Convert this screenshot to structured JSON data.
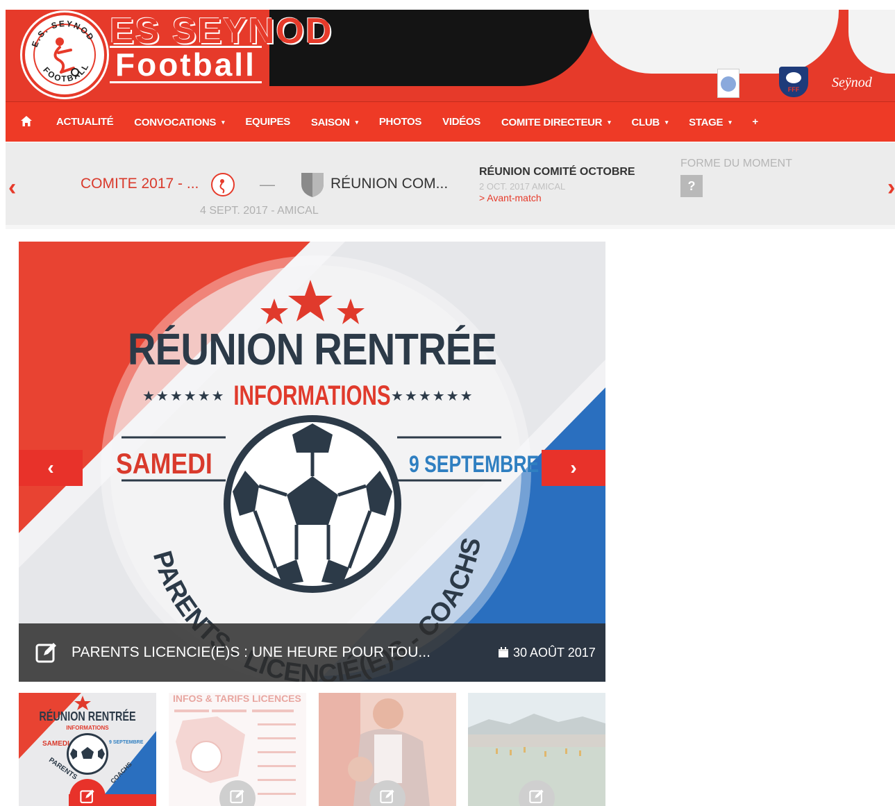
{
  "header": {
    "club_name_line1": "ES SEYNOD",
    "club_name_line2": "Football",
    "logo_text_top": "E.S. SEYNOD",
    "logo_text_bottom": "FOOTBALL",
    "partner_seynod": "Seÿnod",
    "partner_fff": "FFF"
  },
  "nav": {
    "items": [
      {
        "label": "ACTUALITÉ",
        "dropdown": false
      },
      {
        "label": "CONVOCATIONS",
        "dropdown": true
      },
      {
        "label": "EQUIPES",
        "dropdown": false
      },
      {
        "label": "SAISON",
        "dropdown": true
      },
      {
        "label": "PHOTOS",
        "dropdown": false
      },
      {
        "label": "VIDÉOS",
        "dropdown": false
      },
      {
        "label": "COMITE DIRECTEUR",
        "dropdown": true
      },
      {
        "label": "CLUB",
        "dropdown": true
      },
      {
        "label": "STAGE",
        "dropdown": true
      },
      {
        "label": "+",
        "dropdown": false
      }
    ],
    "home_icon": "home-icon",
    "caret": "▾"
  },
  "matchbar": {
    "prev_arrow": "‹",
    "next_arrow": "›",
    "last_match": {
      "team_home": "COMITE 2017 - ...",
      "separator": "—",
      "team_away": "RÉUNION COM...",
      "date": "4 SEPT. 2017 - AMICAL"
    },
    "next_match": {
      "title": "RÉUNION COMITÉ OCTOBRE",
      "date": "2 OCT. 2017 AMICAL",
      "link": "> Avant-match"
    },
    "form": {
      "title": "FORME DU MOMENT",
      "badge": "?"
    }
  },
  "slider": {
    "headline": "RÉUNION RENTRÉE",
    "subhead": "INFORMATIONS",
    "stars": "★★★★★★",
    "day": "SAMEDI",
    "date": "9 SEPTEMBRE",
    "arc_text": "PARENTS - LICENCIÉ(E)S - COACHS",
    "prev_arrow": "‹",
    "next_arrow": "›",
    "caption": "PARENTS LICENCIE(E)S : UNE HEURE POUR TOU...",
    "caption_date": "30 AOÛT 2017"
  },
  "thumbnails": [
    {
      "title": "RÉUNION RENTRÉE",
      "subtitle": "INFORMATIONS",
      "day": "SAMEDI",
      "date": "9 SEPTEMBRE",
      "arc": "PARENTS",
      "arc2": "COACHS"
    },
    {
      "title": "INFOS & TARIFS LICENCES"
    },
    {
      "title": ""
    },
    {
      "title": ""
    }
  ],
  "colors": {
    "brand_red": "#e63a2a",
    "nav_red": "#ee3a26",
    "dark_navy": "#2c3a48",
    "blue": "#2f7fc1"
  }
}
